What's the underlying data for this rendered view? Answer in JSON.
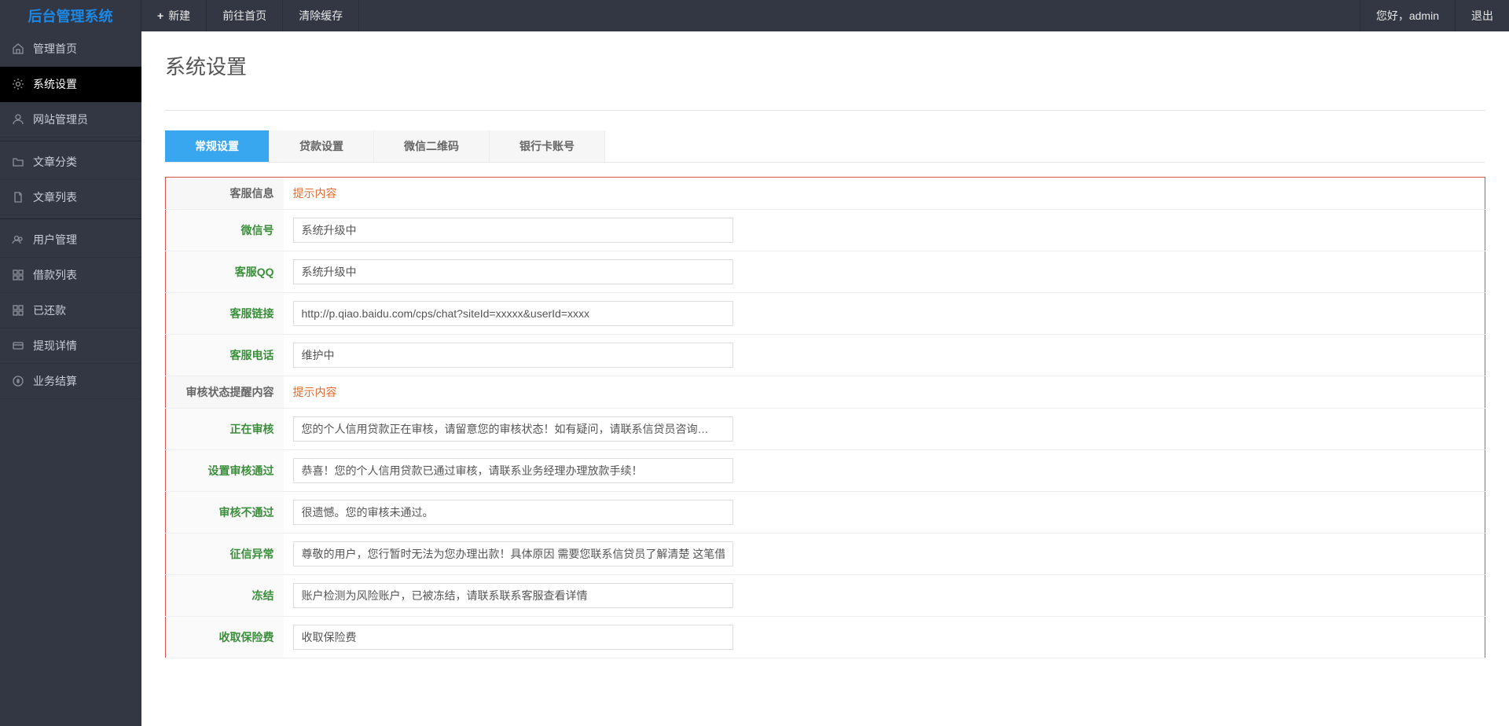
{
  "logo": "后台管理系统",
  "top_menu": {
    "new": "新建",
    "home": "前往首页",
    "clear_cache": "清除缓存"
  },
  "welcome": "您好，admin",
  "logout": "退出",
  "sidebar": {
    "items": [
      {
        "label": "管理首页"
      },
      {
        "label": "系统设置"
      },
      {
        "label": "网站管理员"
      },
      {
        "label": "文章分类"
      },
      {
        "label": "文章列表"
      },
      {
        "label": "用户管理"
      },
      {
        "label": "借款列表"
      },
      {
        "label": "已还款"
      },
      {
        "label": "提现详情"
      },
      {
        "label": "业务结算"
      }
    ]
  },
  "page_title": "系统设置",
  "tabs": [
    {
      "label": "常规设置"
    },
    {
      "label": "贷款设置"
    },
    {
      "label": "微信二维码"
    },
    {
      "label": "银行卡账号"
    }
  ],
  "form": {
    "section1_label": "客服信息",
    "section1_hint": "提示内容",
    "wechat_label": "微信号",
    "wechat_value": "系统升级中",
    "qq_label": "客服QQ",
    "qq_value": "系统升级中",
    "link_label": "客服链接",
    "link_value": "http://p.qiao.baidu.com/cps/chat?siteId=xxxxx&userId=xxxx",
    "phone_label": "客服电话",
    "phone_value": "维护中",
    "section2_label": "审核状态提醒内容",
    "section2_hint": "提示内容",
    "reviewing_label": "正在审核",
    "reviewing_value": "您的个人信用贷款正在审核，请留意您的审核状态！如有疑问，请联系信贷员咨询…",
    "approved_label": "设置审核通过",
    "approved_value": "恭喜！您的个人信用贷款已通过审核，请联系业务经理办理放款手续！",
    "rejected_label": "审核不通过",
    "rejected_value": "很遗憾。您的审核未通过。",
    "credit_label": "征信异常",
    "credit_value": "尊敬的用户，您行暂时无法为您办理出款！具体原因 需要您联系信贷员了解清楚 这笔借款具体到账时",
    "frozen_label": "冻结",
    "frozen_value": "账户检测为风险账户，已被冻结，请联系联系客服查看详情",
    "insurance_label": "收取保险费",
    "insurance_value": "收取保险费"
  }
}
